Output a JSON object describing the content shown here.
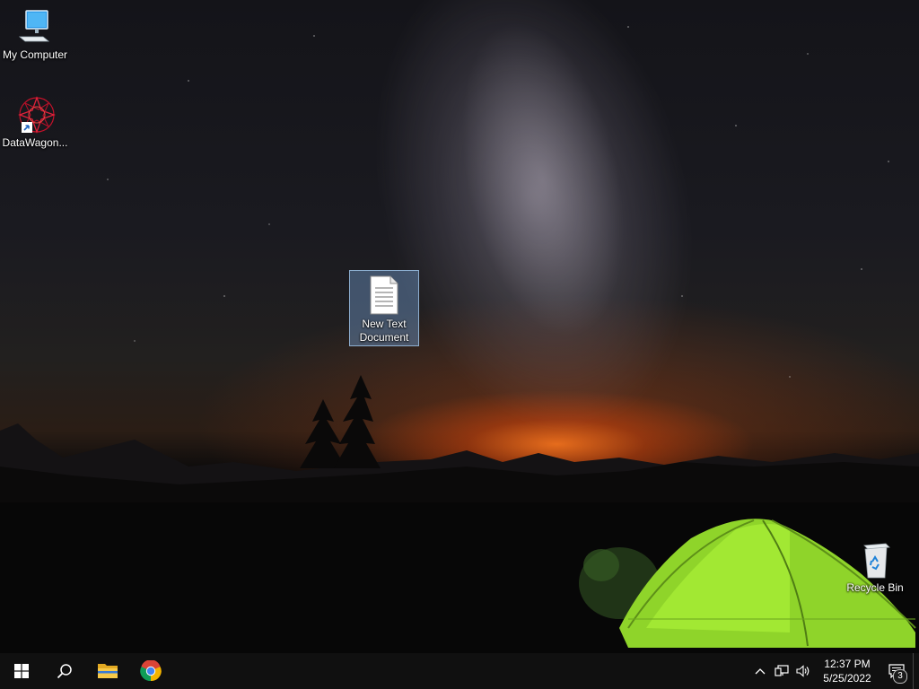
{
  "desktop": {
    "icons": [
      {
        "label": "My Computer",
        "icon": "computer-icon"
      },
      {
        "label": "DataWagon...",
        "icon": "datawagon-app-icon"
      },
      {
        "label": "New Text Document",
        "label_line1": "New Text",
        "label_line2": "Document",
        "icon": "text-document-icon",
        "selected": true
      },
      {
        "label": "Recycle Bin",
        "icon": "recycle-bin-icon"
      }
    ]
  },
  "taskbar": {
    "pinned": [
      {
        "name": "Start",
        "icon": "windows-logo-icon"
      },
      {
        "name": "Search",
        "icon": "search-icon"
      },
      {
        "name": "File Explorer",
        "icon": "folder-icon"
      },
      {
        "name": "Google Chrome",
        "icon": "chrome-icon"
      }
    ],
    "tray": {
      "icons": [
        "chevron-up-icon",
        "network-icon",
        "volume-icon"
      ],
      "time": "12:37 PM",
      "date": "5/25/2022",
      "notification_count": "3"
    }
  },
  "colors": {
    "selection": "#6e96c8",
    "taskbar": "#101010",
    "tent": "#9be22c"
  }
}
